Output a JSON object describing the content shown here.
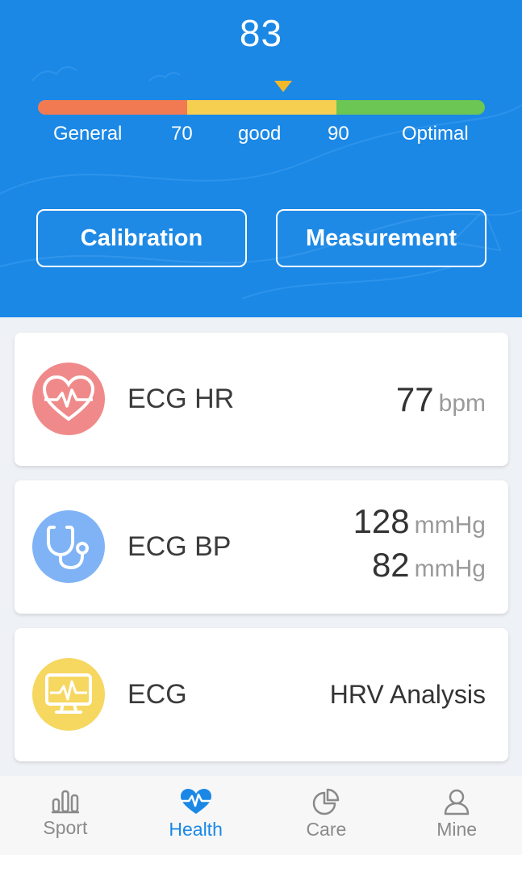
{
  "score": {
    "value": "83",
    "bar_colors": [
      "#f27a52",
      "#f7cf50",
      "#6cc654"
    ],
    "marker_color": "#f4b92a",
    "labels": {
      "general": "General",
      "low_threshold": "70",
      "good": "good",
      "high_threshold": "90",
      "optimal": "Optimal"
    }
  },
  "actions": {
    "calibration": "Calibration",
    "measurement": "Measurement"
  },
  "cards": {
    "hr": {
      "title": "ECG HR",
      "value": "77",
      "unit": "bpm",
      "icon": "heart-ecg-icon",
      "icon_color": "#f08a8a"
    },
    "bp": {
      "title": "ECG BP",
      "systolic": "128",
      "diastolic": "82",
      "unit": "mmHg",
      "icon": "stethoscope-icon",
      "icon_color": "#7fb3f5"
    },
    "ecg": {
      "title": "ECG",
      "action": "HRV Analysis",
      "icon": "monitor-ecg-icon",
      "icon_color": "#f6d760"
    }
  },
  "nav": {
    "sport": "Sport",
    "health": "Health",
    "care": "Care",
    "mine": "Mine",
    "active": "Health"
  },
  "colors": {
    "primary": "#1b88e6",
    "inactive": "#8a8a8a"
  }
}
